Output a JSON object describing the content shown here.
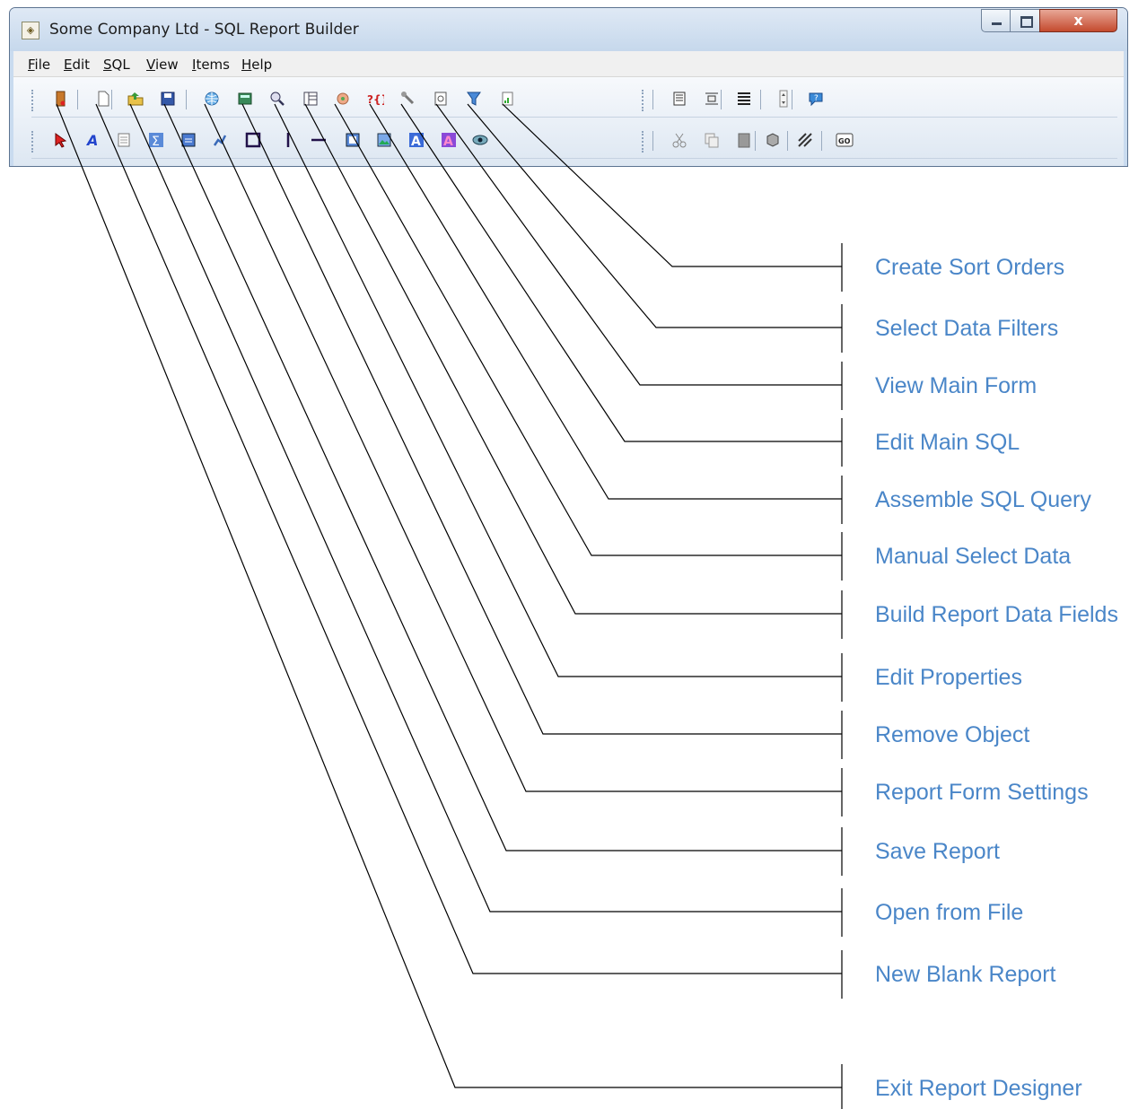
{
  "window": {
    "title": "Some Company Ltd - SQL Report Builder",
    "close_glyph": "x",
    "menu": [
      "File",
      "Edit",
      "SQL",
      "View",
      "Items",
      "Help"
    ]
  },
  "toolbar": {
    "row1_icons": [
      "exit-door-icon",
      "new-page-icon",
      "open-folder-icon",
      "save-disk-icon",
      "globe-icon",
      "report-settings-icon",
      "search-magnifier-icon",
      "properties-panel-icon",
      "build-fields-icon",
      "sql-query-icon",
      "wrench-icon",
      "main-form-icon",
      "filter-funnel-icon",
      "sort-orders-icon"
    ],
    "row1_right_icons": [
      "align-list-icon",
      "band-icon",
      "list-lines-icon",
      "spin-arrows-icon",
      "help-icon"
    ],
    "row2_icons": [
      "pointer-arrow-icon",
      "text-a-icon",
      "memo-icon",
      "sum-icon",
      "calc-field-icon",
      "chart-icon",
      "rectangle-icon",
      "vertical-line-icon",
      "horizontal-line-icon",
      "image-icon",
      "picture-icon",
      "rich-text-icon",
      "shape-a-icon",
      "eye-icon"
    ],
    "row2_right_icons": [
      "cut-icon",
      "copy-icon",
      "paste-icon",
      "layers-icon",
      "hatch-icon",
      "go-icon"
    ],
    "go_label": "GO"
  },
  "callouts": [
    {
      "label": "Create Sort Orders"
    },
    {
      "label": "Select Data Filters"
    },
    {
      "label": "View Main Form"
    },
    {
      "label": "Edit Main SQL"
    },
    {
      "label": "Assemble SQL Query"
    },
    {
      "label": "Manual Select Data"
    },
    {
      "label": "Build Report Data Fields"
    },
    {
      "label": "Edit Properties"
    },
    {
      "label": "Remove Object"
    },
    {
      "label": "Report Form Settings"
    },
    {
      "label": "Save Report"
    },
    {
      "label": "Open from File"
    },
    {
      "label": "New Blank Report"
    },
    {
      "label": "Exit Report Designer"
    }
  ],
  "colors": {
    "label": "#4a86c8",
    "line": "#000000",
    "frame": "#c9dbef"
  }
}
